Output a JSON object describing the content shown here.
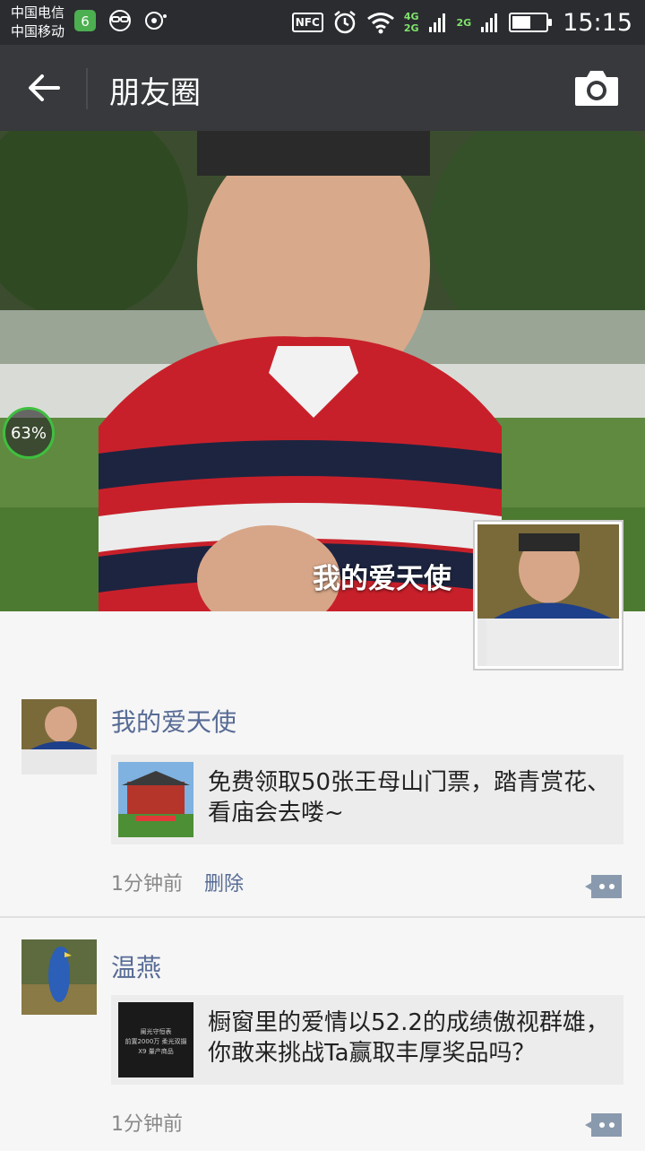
{
  "status_bar": {
    "carrier_1": "中国电信",
    "carrier_2": "中国移动",
    "nfc_label": "NFC",
    "net_label_top": "4G",
    "net_label_bottom": "2G",
    "net_label_single": "2G",
    "battery_level": 0.55,
    "time": "15:15"
  },
  "action_bar": {
    "back_icon": "arrow-left-icon",
    "title": "朋友圈",
    "camera_icon": "camera-icon"
  },
  "cover": {
    "progress_badge": "63%",
    "profile_name": "我的爱天使"
  },
  "feed": {
    "posts": [
      {
        "author": "我的爱天使",
        "link_text": "免费领取50张王母山门票，踏青赏花、看庙会去喽~",
        "time": "1分钟前",
        "delete_label": "删除"
      },
      {
        "author": "温燕",
        "link_text": "橱窗里的爱情以52.2的成绩傲视群雄，你敢来挑战Ta赢取丰厚奖品吗？",
        "thumb_text_1": "阑光守恒表",
        "thumb_text_2": "前置2000万 柔光双摄",
        "thumb_text_3": "X9 量产商品",
        "time": "1分钟前"
      }
    ]
  },
  "colors": {
    "status_bar_bg": "#2a2c30",
    "action_bar_bg": "#37393d",
    "link_color": "#576b95",
    "feed_bg": "#f6f6f6"
  }
}
